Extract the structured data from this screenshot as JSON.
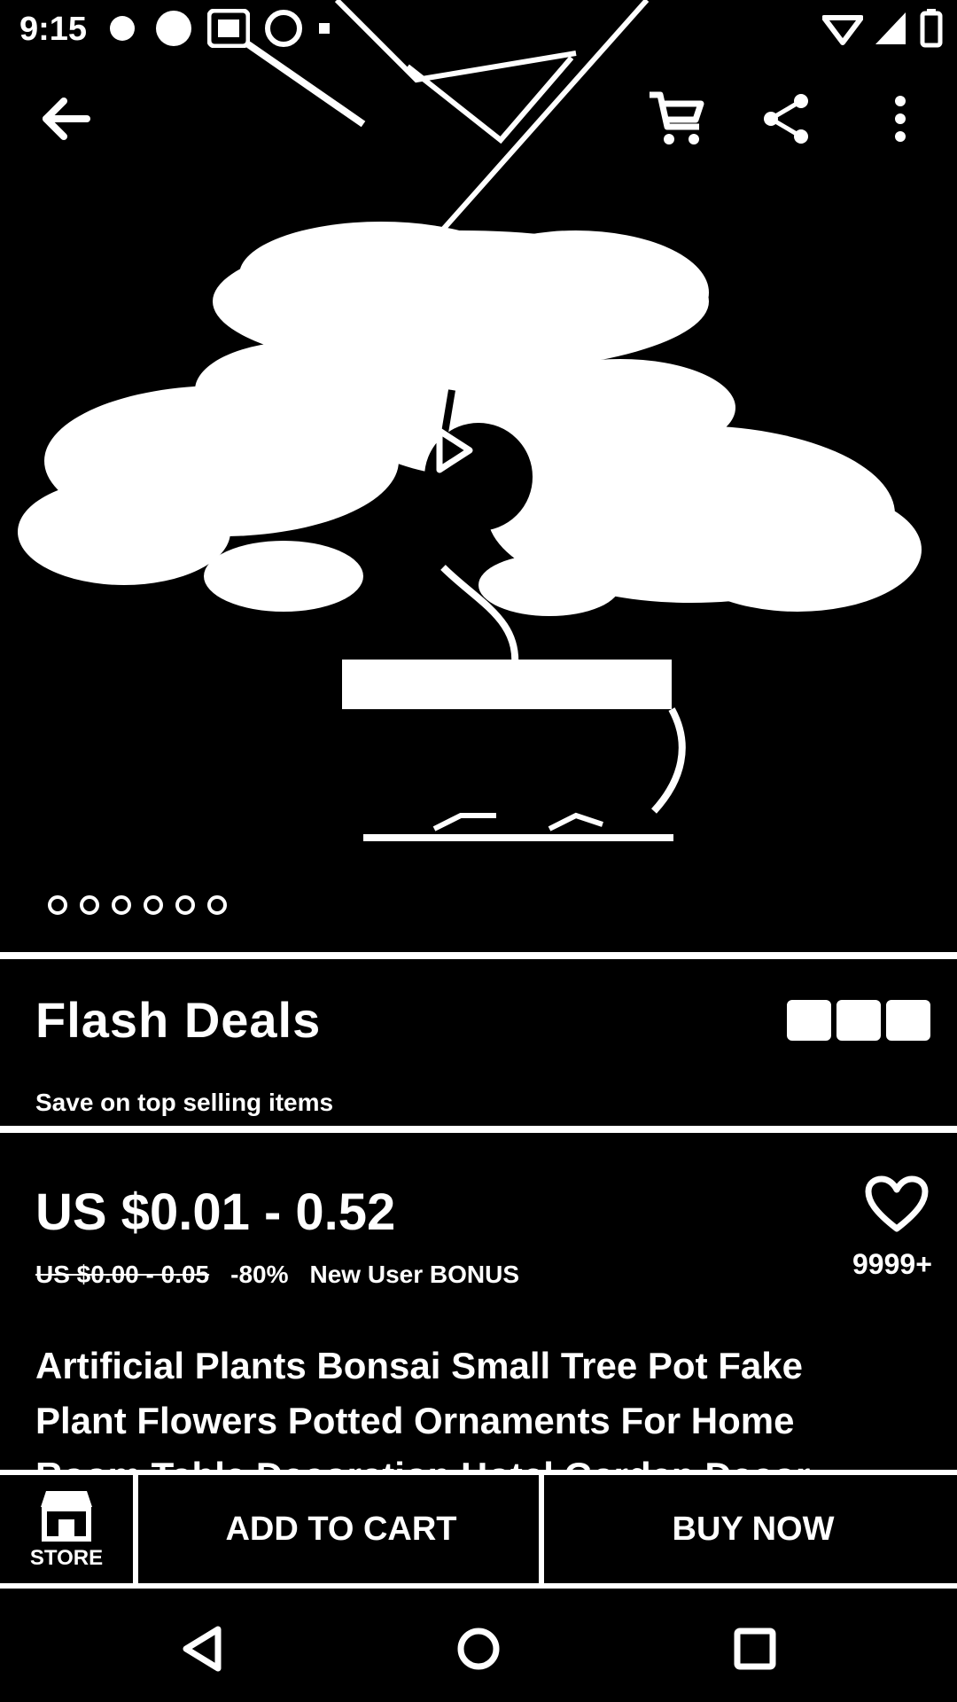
{
  "status_bar": {
    "time": "9:15"
  },
  "toolbar": {
    "back_icon": "arrow-left-icon",
    "cart_icon": "cart-icon",
    "share_icon": "share-icon",
    "more_icon": "more-vertical-icon"
  },
  "hero": {
    "image_subject": "bonsai",
    "play_icon": "play-icon",
    "dot_count": 6
  },
  "flash_deals": {
    "title": "Flash Deals",
    "subtitle": "Save on top selling items"
  },
  "price": {
    "main": "US $0.01 - 0.52",
    "original": "US $0.00 - 0.05",
    "discount": "-80%",
    "new_user": "New User BONUS",
    "wishlist_count": "9999+"
  },
  "product": {
    "title": "Artificial Plants Bonsai Small Tree Pot Fake Plant Flowers Potted Ornaments For Home Room Table Decoration Hotel Garden Decor"
  },
  "actions": {
    "store_label": "STORE",
    "add_to_cart": "ADD TO CART",
    "buy_now": "BUY NOW"
  },
  "colors": {
    "background": "#000000",
    "foreground": "#ffffff"
  }
}
